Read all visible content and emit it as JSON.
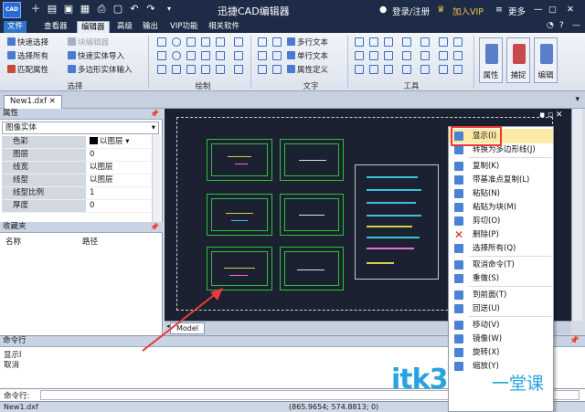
{
  "app": {
    "logo": "CAD",
    "title": "迅捷CAD编辑器",
    "login": "登录/注册",
    "vip": "加入VIP",
    "more": "更多"
  },
  "menu": [
    "文件",
    "查看器",
    "编辑器",
    "高级",
    "输出",
    "VIP功能",
    "相关软件"
  ],
  "ribbon": {
    "select": {
      "items": [
        "快速选择",
        "选择所有",
        "匹配属性",
        "块编辑器",
        "快速实体导入",
        "多边形实体输入"
      ],
      "label": "选择"
    },
    "draw": {
      "label": "绘制"
    },
    "text": {
      "items": [
        "多行文本",
        "单行文本",
        "属性定义"
      ],
      "label": "文字"
    },
    "tools": {
      "label": "工具"
    },
    "big": [
      "属性",
      "捕捉",
      "编辑"
    ]
  },
  "doc_tab": "New1.dxf",
  "properties": {
    "header": "属性",
    "selected": "图像实体",
    "rows": [
      {
        "k": "色彩",
        "v": "以图层"
      },
      {
        "k": "图层",
        "v": "0"
      },
      {
        "k": "线宽",
        "v": "以图层"
      },
      {
        "k": "线型",
        "v": "以图层"
      },
      {
        "k": "线型比例",
        "v": "1"
      },
      {
        "k": "厚度",
        "v": "0"
      }
    ]
  },
  "favorites": {
    "header": "收藏夹",
    "col1": "名称",
    "col2": "路径"
  },
  "model_tab": "Model",
  "command": {
    "header": "命令行",
    "lines": [
      "显示l",
      "取消"
    ],
    "label": "命令行:"
  },
  "status": {
    "file": "New1.dxf",
    "coords": "(865.9654; 574.8813; 0)"
  },
  "context_menu": [
    {
      "label": "显示(I)",
      "hl": true
    },
    {
      "label": "转换为多边形线(J)"
    },
    {
      "sep": true
    },
    {
      "label": "复制(K)"
    },
    {
      "label": "带基准点复制(L)"
    },
    {
      "label": "粘贴(N)"
    },
    {
      "label": "粘贴为块(M)"
    },
    {
      "label": "剪切(O)"
    },
    {
      "label": "删除(P)",
      "red": true
    },
    {
      "label": "选择所有(Q)"
    },
    {
      "sep": true
    },
    {
      "label": "取消命令(T)"
    },
    {
      "label": "重做(S)"
    },
    {
      "sep": true
    },
    {
      "label": "到前面(T)"
    },
    {
      "label": "回送(U)"
    },
    {
      "sep": true
    },
    {
      "label": "移动(V)"
    },
    {
      "label": "镜像(W)"
    },
    {
      "label": "旋转(X)"
    },
    {
      "label": "缩放(Y)"
    }
  ],
  "watermark": {
    "brand": "itk3",
    "cn": "一堂课"
  },
  "colors": {
    "titlebar": "#1d2b47",
    "canvas": "#1b2130",
    "highlight": "#e83a3a",
    "cad_green": "#2fbf3c"
  }
}
